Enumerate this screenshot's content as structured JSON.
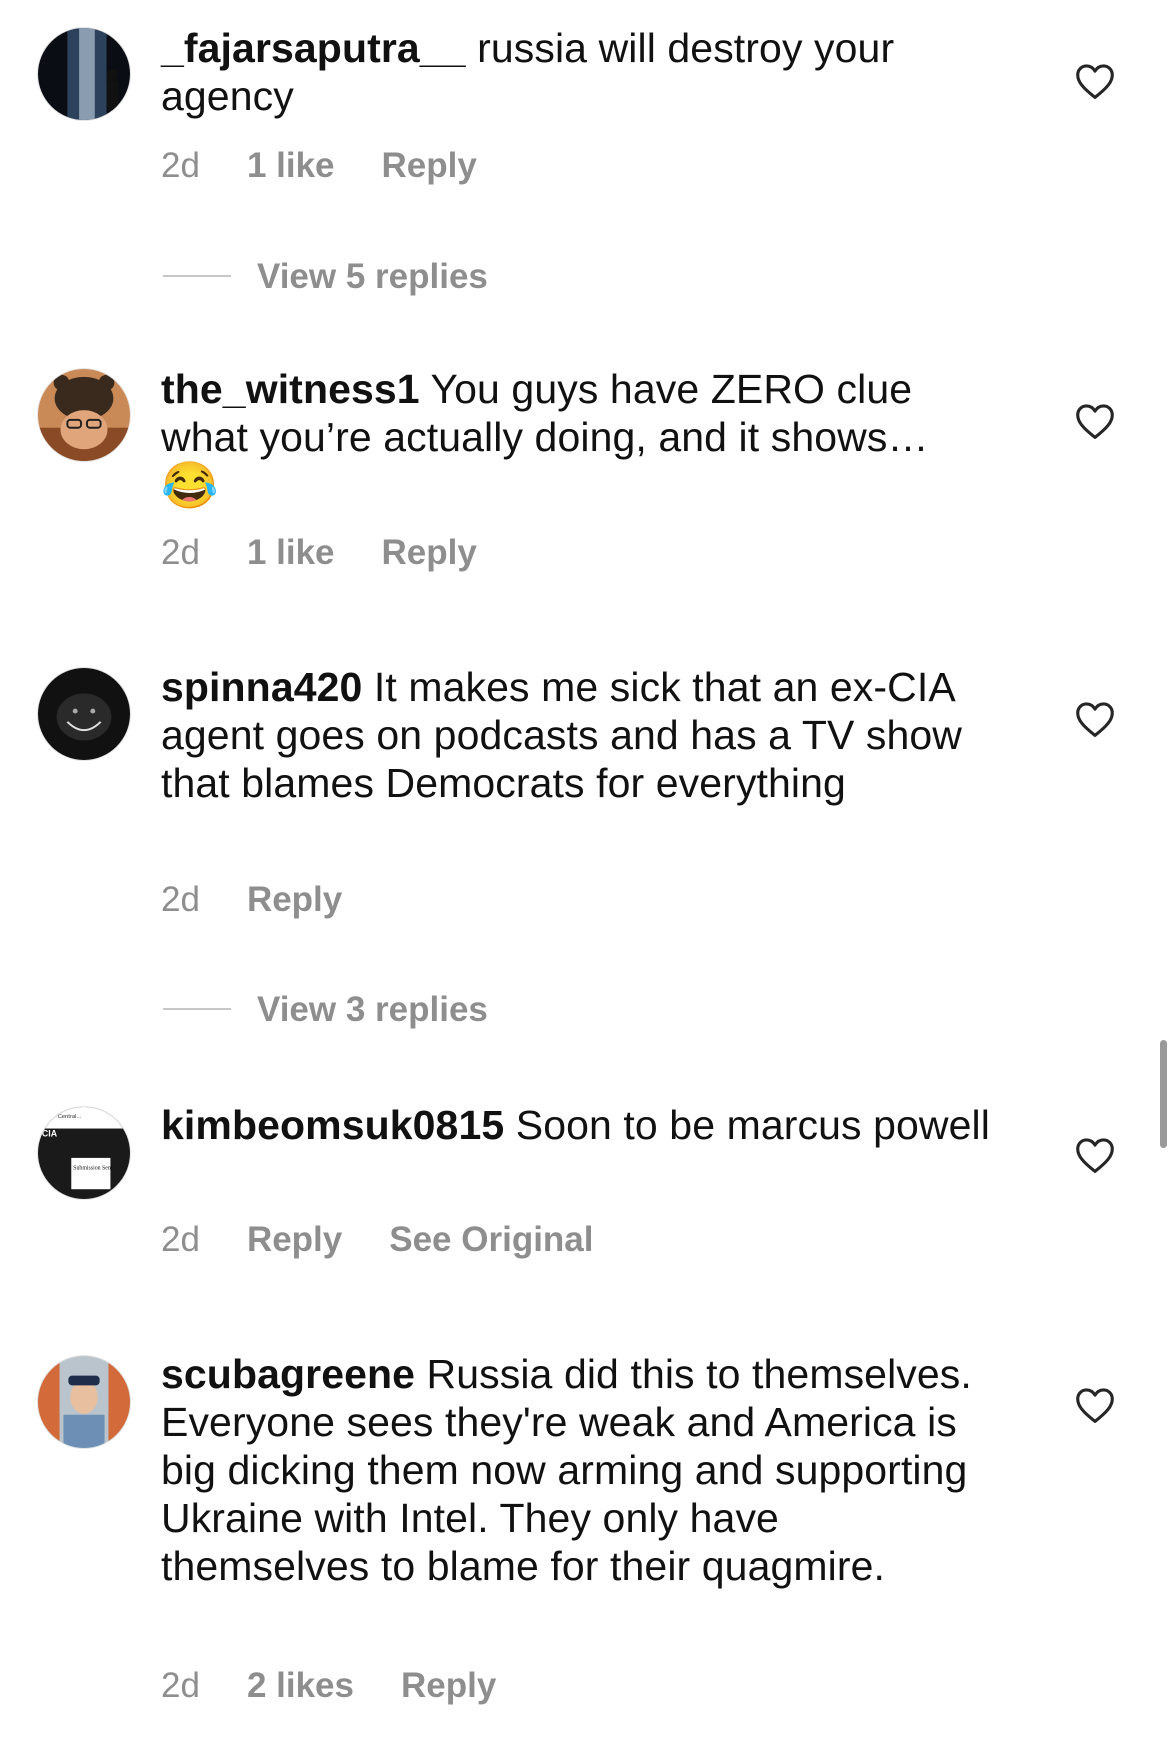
{
  "comments": [
    {
      "username": "_fajarsaputra__",
      "text": " russia will destroy your agency",
      "time": "2d",
      "likes": "1 like",
      "reply": "Reply"
    },
    {
      "username": "the_witness1",
      "text": " You guys have ZERO clue what you’re actually doing, and it shows…",
      "emoji": "😂",
      "time": "2d",
      "likes": "1 like",
      "reply": "Reply"
    },
    {
      "username": "spinna420",
      "text": " It makes me sick that an ex-CIA agent goes on podcasts and has a TV show that blames Democrats for everything",
      "time": "2d",
      "reply": "Reply"
    },
    {
      "username": "kimbeomsuk0815",
      "text": " Soon to be marcus powell",
      "time": "2d",
      "reply": "Reply",
      "see_original": "See Original"
    },
    {
      "username": "scubagreene",
      "text": " Russia did this to themselves. Everyone sees they're weak and America is big dicking them now arming and supporting Ukraine with Intel. They only have themselves to blame for their quagmire.",
      "time": "2d",
      "likes": "2 likes",
      "reply": "Reply"
    }
  ],
  "view_replies": [
    "View 5 replies",
    "View 3 replies"
  ],
  "avatar_thumbnail_text": {
    "cia_label": "CIA",
    "cia_header": "Central...",
    "submission": "Submission Sent"
  },
  "colors": {
    "meta_gray": "#8e8e8e",
    "text": "#111111",
    "divider": "#c7c7c7"
  },
  "icons": [
    "heart-outline-icon"
  ]
}
